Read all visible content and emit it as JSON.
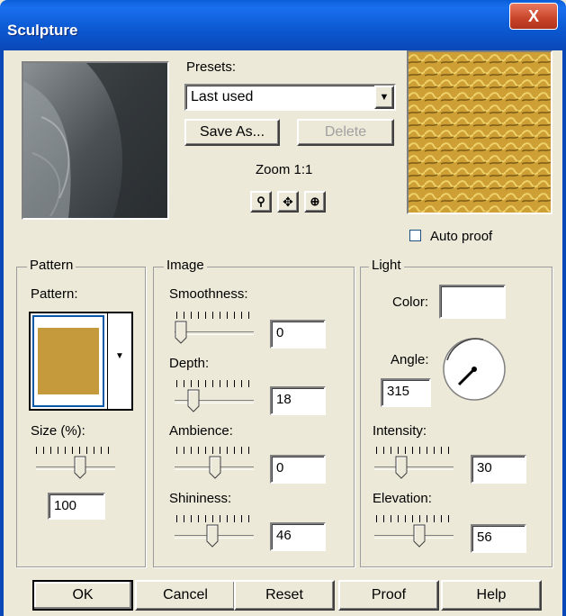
{
  "window": {
    "title": "Sculpture",
    "close_glyph": "X"
  },
  "presets": {
    "label": "Presets:",
    "selected": "Last used",
    "save_as_label": "Save As...",
    "delete_label": "Delete"
  },
  "zoom": {
    "label": "Zoom 1:1",
    "zoom_out_icon": "zoom-out-icon",
    "pan_icon": "pan-icon",
    "zoom_in_icon": "zoom-in-icon"
  },
  "auto_proof": {
    "label": "Auto proof",
    "checked": false
  },
  "pattern_group": {
    "legend": "Pattern",
    "pattern_label": "Pattern:",
    "swatch_color": "#c49a3c",
    "size_label": "Size (%):",
    "size_value": "100",
    "size_slider_fraction": 0.55
  },
  "image_group": {
    "legend": "Image",
    "smoothness_label": "Smoothness:",
    "smoothness_value": "0",
    "smoothness_fraction": 0.0,
    "depth_label": "Depth:",
    "depth_value": "18",
    "depth_fraction": 0.18,
    "ambience_label": "Ambience:",
    "ambience_value": "0",
    "ambience_fraction": 0.5,
    "shininess_label": "Shininess:",
    "shininess_value": "46",
    "shininess_fraction": 0.46
  },
  "light_group": {
    "legend": "Light",
    "color_label": "Color:",
    "color_value": "#ffffff",
    "angle_label": "Angle:",
    "angle_value": "315",
    "intensity_label": "Intensity:",
    "intensity_value": "30",
    "intensity_fraction": 0.3,
    "elevation_label": "Elevation:",
    "elevation_value": "56",
    "elevation_fraction": 0.56
  },
  "buttons": {
    "ok": "OK",
    "cancel": "Cancel",
    "reset": "Reset",
    "proof": "Proof",
    "help": "Help"
  }
}
